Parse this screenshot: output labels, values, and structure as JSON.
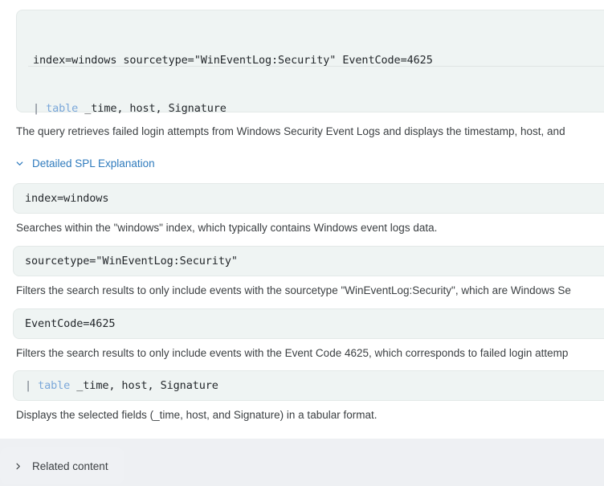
{
  "main_query": {
    "line1": "index=windows sourcetype=\"WinEventLog:Security\" EventCode=4625",
    "line2_pipe": "|",
    "line2_keyword": "table",
    "line2_rest": " _time, host, Signature"
  },
  "summary": "The query retrieves failed login attempts from Windows Security Event Logs and displays the timestamp, host, and",
  "detailed_section": {
    "title": "Detailed SPL Explanation",
    "chevron": "chevron-down-icon",
    "expanded": true,
    "items": [
      {
        "code": "index=windows",
        "description": "Searches within the \"windows\" index, which typically contains Windows event logs data."
      },
      {
        "code": "sourcetype=\"WinEventLog:Security\"",
        "description": "Filters the search results to only include events with the sourcetype \"WinEventLog:Security\", which are Windows Se"
      },
      {
        "code": "EventCode=4625",
        "description": "Filters the search results to only include events with the Event Code 4625, which corresponds to failed login attemp"
      },
      {
        "code_pipe": "|",
        "code_keyword": "table",
        "code_rest": " _time, host, Signature",
        "description": "Displays the selected fields (_time, host, and Signature) in a tabular format."
      }
    ]
  },
  "related_content": {
    "label": "Related content",
    "chevron": "chevron-right-icon",
    "expanded": false
  },
  "colors": {
    "page_background": "#eef0f3",
    "card_background": "#ffffff",
    "code_background": "#eff4f3",
    "code_border": "#e3e9e8",
    "link_accent": "#2f7bbd",
    "keyword": "#7aa7d9",
    "body_text": "#3c4043"
  }
}
